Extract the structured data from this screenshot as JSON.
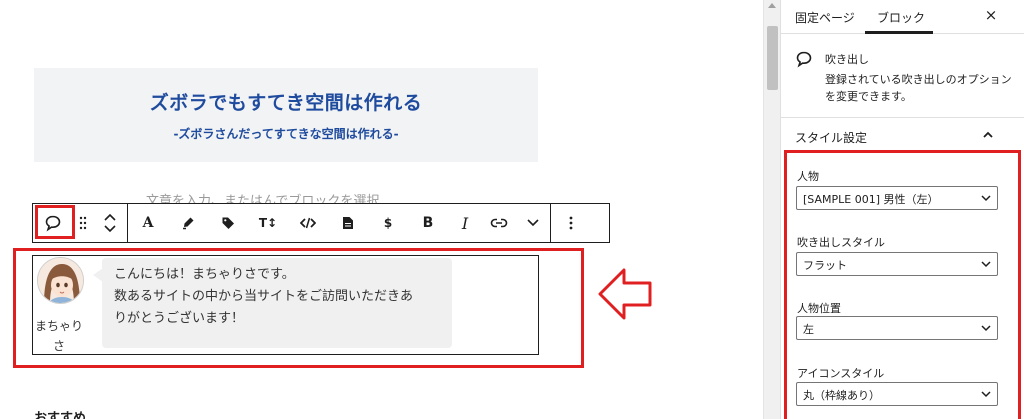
{
  "editor": {
    "heading": {
      "title": "ズボラでもすてき空間は作れる",
      "subtitle": "-ズボラさんだってすてきな空間は作れる-"
    },
    "placeholder": "文章を入力、またはんでブロックを選択",
    "toolbar": {
      "buttons": [
        "balloon-icon",
        "drag-handle-icon",
        "move-up-icon",
        "move-down-icon",
        "font-color",
        "highlighter-icon",
        "tag-icon",
        "font-size",
        "code-icon",
        "document-icon",
        "dollar",
        "bold",
        "italic",
        "link-icon",
        "chevron-down-icon",
        "more-options-icon"
      ],
      "font_color_label": "A",
      "font_size_label": "T↕",
      "dollar_label": "$",
      "bold_label": "B",
      "italic_label": "I"
    },
    "balloon": {
      "name": "まちゃりさ",
      "lines": [
        "こんにちは！まちゃりさです。",
        "数あるサイトの中から当サイトをご訪問いただきあ",
        "りがとうございます！"
      ]
    },
    "bottom_partial": "おすすめ"
  },
  "sidebar": {
    "tabs": [
      {
        "label": "固定ページ",
        "active": false
      },
      {
        "label": "ブロック",
        "active": true
      }
    ],
    "close_label": "×",
    "block_card": {
      "title": "吹き出し",
      "description": "登録されている吹き出しのオプションを変更できます。"
    },
    "panel_title": "スタイル設定",
    "fields": [
      {
        "label": "人物",
        "value": "[SAMPLE 001] 男性（左）"
      },
      {
        "label": "吹き出しスタイル",
        "value": "フラット"
      },
      {
        "label": "人物位置",
        "value": "左"
      },
      {
        "label": "アイコンスタイル",
        "value": "丸（枠線あり）"
      }
    ]
  },
  "colors": {
    "accent_red": "#e02020",
    "heading_blue": "#1f4b9e",
    "heading_bg": "#f1f3f5",
    "bubble_bg": "#f0f0f0"
  }
}
